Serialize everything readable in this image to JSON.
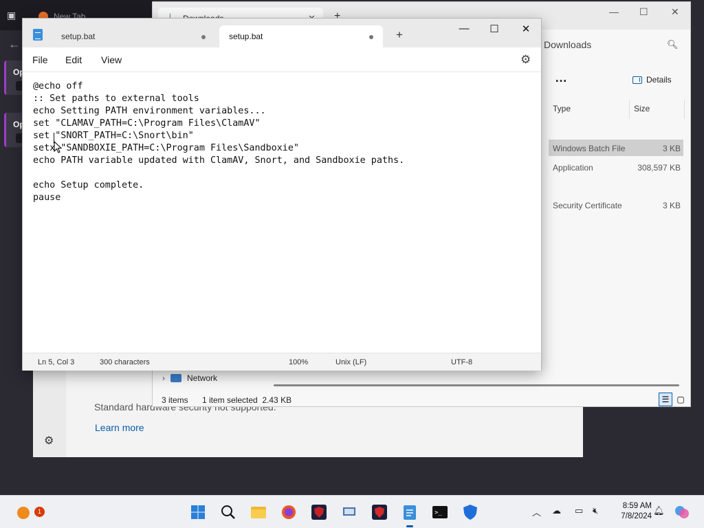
{
  "browser": {
    "tab_title": "New Tab",
    "card_label": "Op"
  },
  "security": {
    "message": "Standard hardware security not supported.",
    "learn_more": "Learn more"
  },
  "explorer": {
    "tab_title": "Downloads",
    "breadcrumb": "Downloads",
    "toolbar_more": "…",
    "details_label": "Details",
    "columns": {
      "type": "Type",
      "size": "Size"
    },
    "rows": [
      {
        "type": "Windows Batch File",
        "size": "3 KB",
        "selected": true
      },
      {
        "type": "Application",
        "size": "308,597 KB",
        "selected": false
      },
      {
        "type": "Security Certificate",
        "size": "3 KB",
        "selected": false
      }
    ],
    "nav_network": "Network",
    "status_items": "3 items",
    "status_selected": "1 item selected  2.43 KB"
  },
  "notepad": {
    "tabs": [
      {
        "label": "setup.bat",
        "active": false,
        "modified": true
      },
      {
        "label": "setup.bat",
        "active": true,
        "modified": true
      }
    ],
    "menu": {
      "file": "File",
      "edit": "Edit",
      "view": "View"
    },
    "lines": [
      "@echo off",
      ":: Set paths to external tools",
      "echo Setting PATH environment variables...",
      "set \"CLAMAV_PATH=C:\\Program Files\\ClamAV\"",
      "set \"SNORT_PATH=C:\\Snort\\bin\"",
      "setx \"SANDBOXIE_PATH=C:\\Program Files\\Sandboxie\"",
      "echo PATH variable updated with ClamAV, Snort, and Sandboxie paths.",
      "",
      "echo Setup complete.",
      "pause"
    ],
    "status": {
      "position": "Ln 5, Col 3",
      "characters": "300 characters",
      "zoom": "100%",
      "line_ending": "Unix (LF)",
      "encoding": "UTF-8"
    }
  },
  "taskbar": {
    "notification_count": "1",
    "time": "8:59 AM",
    "date": "7/8/2024",
    "accent": "#0a5ba8"
  }
}
